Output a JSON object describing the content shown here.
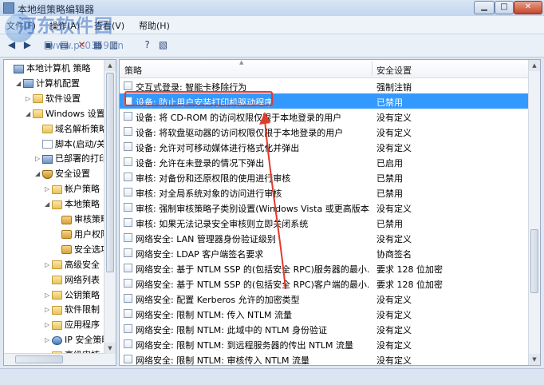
{
  "window": {
    "title": "本地组策略编辑器",
    "min_label": "▁",
    "max_label": "□",
    "close_label": "✕"
  },
  "watermark": {
    "text": "河东软件园",
    "sub": "www.pc0359.cn"
  },
  "menu": [
    {
      "label": "文件(F)"
    },
    {
      "label": "操作(A)"
    },
    {
      "label": "查看(V)"
    },
    {
      "label": "帮助(H)"
    }
  ],
  "tree": {
    "items": [
      {
        "label": "本地计算机 策略",
        "icon": "computer-icon",
        "level": 0,
        "toggle": ""
      },
      {
        "label": "计算机配置",
        "icon": "computer-icon",
        "level": 1,
        "toggle": "◢"
      },
      {
        "label": "软件设置",
        "icon": "folder-icon",
        "level": 2,
        "toggle": "▷"
      },
      {
        "label": "Windows 设置",
        "icon": "folder-icon",
        "level": 2,
        "toggle": "◢"
      },
      {
        "label": "域名解析策略",
        "icon": "folder-icon",
        "level": 3,
        "toggle": ""
      },
      {
        "label": "脚本(启动/关机)",
        "icon": "doc-icon",
        "level": 3,
        "toggle": ""
      },
      {
        "label": "已部署的打印机",
        "icon": "printer-icon",
        "level": 3,
        "toggle": "▷"
      },
      {
        "label": "安全设置",
        "icon": "shield-icon",
        "level": 3,
        "toggle": "◢"
      },
      {
        "label": "帐户策略",
        "icon": "folder-icon",
        "level": 4,
        "toggle": "▷"
      },
      {
        "label": "本地策略",
        "icon": "folder-icon",
        "level": 4,
        "toggle": "◢"
      },
      {
        "label": "审核策略",
        "icon": "lock-icon",
        "level": 5,
        "toggle": ""
      },
      {
        "label": "用户权限分配",
        "icon": "lock-icon",
        "level": 5,
        "toggle": ""
      },
      {
        "label": "安全选项",
        "icon": "lock-icon",
        "level": 5,
        "toggle": ""
      },
      {
        "label": "高级安全",
        "icon": "folder-icon",
        "level": 4,
        "toggle": "▷"
      },
      {
        "label": "网络列表",
        "icon": "folder-icon",
        "level": 4,
        "toggle": ""
      },
      {
        "label": "公钥策略",
        "icon": "folder-icon",
        "level": 4,
        "toggle": "▷"
      },
      {
        "label": "软件限制",
        "icon": "folder-icon",
        "level": 4,
        "toggle": "▷"
      },
      {
        "label": "应用程序",
        "icon": "folder-icon",
        "level": 4,
        "toggle": "▷"
      },
      {
        "label": "IP 安全策略",
        "icon": "ip-icon",
        "level": 4,
        "toggle": "▷"
      },
      {
        "label": "高级审核",
        "icon": "folder-icon",
        "level": 4,
        "toggle": "▷"
      }
    ]
  },
  "list": {
    "col_policy": "策略",
    "col_setting": "安全设置",
    "rows": [
      {
        "name": "交互式登录: 智能卡移除行为",
        "value": "强制注销"
      },
      {
        "name": "设备: 防止用户安装打印机驱动程序",
        "value": "已禁用",
        "selected": true
      },
      {
        "name": "设备: 将 CD-ROM 的访问权限仅限于本地登录的用户",
        "value": "没有定义"
      },
      {
        "name": "设备: 将软盘驱动器的访问权限仅限于本地登录的用户",
        "value": "没有定义"
      },
      {
        "name": "设备: 允许对可移动媒体进行格式化并弹出",
        "value": "没有定义"
      },
      {
        "name": "设备: 允许在未登录的情况下弹出",
        "value": "已启用"
      },
      {
        "name": "审核: 对备份和还原权限的使用进行审核",
        "value": "已禁用"
      },
      {
        "name": "审核: 对全局系统对象的访问进行审核",
        "value": "已禁用"
      },
      {
        "name": "审核: 强制审核策略子类别设置(Windows Vista 或更高版本...",
        "value": "没有定义"
      },
      {
        "name": "审核: 如果无法记录安全审核则立即关闭系统",
        "value": "已禁用"
      },
      {
        "name": "网络安全: LAN 管理器身份验证级别",
        "value": "没有定义"
      },
      {
        "name": "网络安全: LDAP 客户端签名要求",
        "value": "协商签名"
      },
      {
        "name": "网络安全: 基于 NTLM SSP 的(包括安全 RPC)服务器的最小...",
        "value": "要求 128 位加密"
      },
      {
        "name": "网络安全: 基于 NTLM SSP 的(包括安全 RPC)客户端的最小...",
        "value": "要求 128 位加密"
      },
      {
        "name": "网络安全: 配置 Kerberos 允许的加密类型",
        "value": "没有定义"
      },
      {
        "name": "网络安全: 限制 NTLM: 传入 NTLM 流量",
        "value": "没有定义"
      },
      {
        "name": "网络安全: 限制 NTLM: 此域中的 NTLM 身份验证",
        "value": "没有定义"
      },
      {
        "name": "网络安全: 限制 NTLM: 到远程服务器的传出 NTLM 流量",
        "value": "没有定义"
      },
      {
        "name": "网络安全: 限制 NTLM: 审核传入 NTLM 流量",
        "value": "没有定义"
      }
    ]
  },
  "colors": {
    "selection": "#3399ff",
    "annotation": "#e23a2a"
  }
}
